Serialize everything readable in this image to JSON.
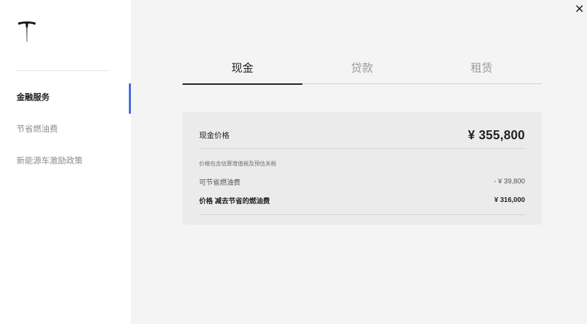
{
  "close_label": "×",
  "sidebar": {
    "items": [
      {
        "label": "金融服务",
        "active": true
      },
      {
        "label": "节省燃油费",
        "active": false
      },
      {
        "label": "新能源车激励政策",
        "active": false
      }
    ]
  },
  "tabs": [
    {
      "label": "现金",
      "active": true
    },
    {
      "label": "贷款",
      "active": false
    },
    {
      "label": "租赁",
      "active": false
    }
  ],
  "card": {
    "cash_price_label": "现金价格",
    "cash_price_value": "¥ 355,800",
    "tax_note": "价格包含估算增值税及预估关税",
    "fuel_savings_label": "可节省燃油费",
    "fuel_savings_value": "- ¥ 39,800",
    "net_price_label": "价格 减去节省的燃油费",
    "net_price_value": "¥ 316,000"
  },
  "colors": {
    "accent": "#3e6ae1",
    "panel_bg": "#f4f4f4",
    "card_bg": "#ebebeb",
    "text_dark": "#222222",
    "text_muted": "#9b9b9b"
  },
  "icons": {
    "logo": "tesla-logo-icon",
    "close": "close-icon"
  }
}
